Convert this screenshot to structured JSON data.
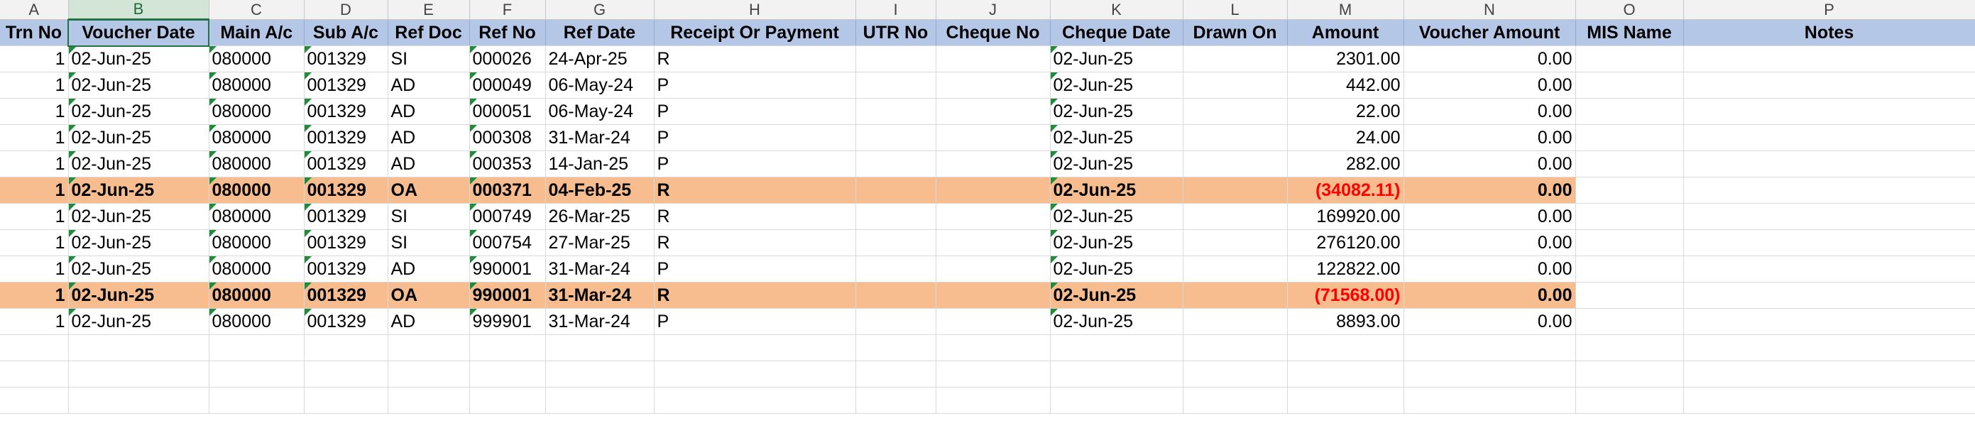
{
  "column_letters": [
    "A",
    "B",
    "C",
    "D",
    "E",
    "F",
    "G",
    "H",
    "I",
    "J",
    "K",
    "L",
    "M",
    "N",
    "O",
    "P"
  ],
  "selected_column": "B",
  "headers": [
    "Trn No",
    "Voucher Date",
    "Main A/c",
    "Sub A/c",
    "Ref Doc",
    "Ref No",
    "Ref Date",
    "Receipt Or Payment",
    "UTR No",
    "Cheque No",
    "Cheque Date",
    "Drawn On",
    "Amount",
    "Voucher Amount",
    "MIS Name",
    "Notes"
  ],
  "highlight_color": "#f8bd8e",
  "header_color": "#b4c7e7",
  "negative_color": "#ff0000",
  "rows": [
    {
      "trn": "1",
      "vdate": "02-Jun-25",
      "main": "080000",
      "sub": "001329",
      "refdoc": "SI",
      "refno": "000026",
      "refdate": "24-Apr-25",
      "rp": "R",
      "utr": "",
      "chq": "",
      "chqdate": "02-Jun-25",
      "drawn": "",
      "amount": "2301.00",
      "vamount": "0.00",
      "mis": "",
      "notes": "",
      "highlight": false,
      "negative": false
    },
    {
      "trn": "1",
      "vdate": "02-Jun-25",
      "main": "080000",
      "sub": "001329",
      "refdoc": "AD",
      "refno": "000049",
      "refdate": "06-May-24",
      "rp": "P",
      "utr": "",
      "chq": "",
      "chqdate": "02-Jun-25",
      "drawn": "",
      "amount": "442.00",
      "vamount": "0.00",
      "mis": "",
      "notes": "",
      "highlight": false,
      "negative": false
    },
    {
      "trn": "1",
      "vdate": "02-Jun-25",
      "main": "080000",
      "sub": "001329",
      "refdoc": "AD",
      "refno": "000051",
      "refdate": "06-May-24",
      "rp": "P",
      "utr": "",
      "chq": "",
      "chqdate": "02-Jun-25",
      "drawn": "",
      "amount": "22.00",
      "vamount": "0.00",
      "mis": "",
      "notes": "",
      "highlight": false,
      "negative": false
    },
    {
      "trn": "1",
      "vdate": "02-Jun-25",
      "main": "080000",
      "sub": "001329",
      "refdoc": "AD",
      "refno": "000308",
      "refdate": "31-Mar-24",
      "rp": "P",
      "utr": "",
      "chq": "",
      "chqdate": "02-Jun-25",
      "drawn": "",
      "amount": "24.00",
      "vamount": "0.00",
      "mis": "",
      "notes": "",
      "highlight": false,
      "negative": false
    },
    {
      "trn": "1",
      "vdate": "02-Jun-25",
      "main": "080000",
      "sub": "001329",
      "refdoc": "AD",
      "refno": "000353",
      "refdate": "14-Jan-25",
      "rp": "P",
      "utr": "",
      "chq": "",
      "chqdate": "02-Jun-25",
      "drawn": "",
      "amount": "282.00",
      "vamount": "0.00",
      "mis": "",
      "notes": "",
      "highlight": false,
      "negative": false
    },
    {
      "trn": "1",
      "vdate": "02-Jun-25",
      "main": "080000",
      "sub": "001329",
      "refdoc": "OA",
      "refno": "000371",
      "refdate": "04-Feb-25",
      "rp": "R",
      "utr": "",
      "chq": "",
      "chqdate": "02-Jun-25",
      "drawn": "",
      "amount": "(34082.11)",
      "vamount": "0.00",
      "mis": "",
      "notes": "",
      "highlight": true,
      "negative": true
    },
    {
      "trn": "1",
      "vdate": "02-Jun-25",
      "main": "080000",
      "sub": "001329",
      "refdoc": "SI",
      "refno": "000749",
      "refdate": "26-Mar-25",
      "rp": "R",
      "utr": "",
      "chq": "",
      "chqdate": "02-Jun-25",
      "drawn": "",
      "amount": "169920.00",
      "vamount": "0.00",
      "mis": "",
      "notes": "",
      "highlight": false,
      "negative": false
    },
    {
      "trn": "1",
      "vdate": "02-Jun-25",
      "main": "080000",
      "sub": "001329",
      "refdoc": "SI",
      "refno": "000754",
      "refdate": "27-Mar-25",
      "rp": "R",
      "utr": "",
      "chq": "",
      "chqdate": "02-Jun-25",
      "drawn": "",
      "amount": "276120.00",
      "vamount": "0.00",
      "mis": "",
      "notes": "",
      "highlight": false,
      "negative": false
    },
    {
      "trn": "1",
      "vdate": "02-Jun-25",
      "main": "080000",
      "sub": "001329",
      "refdoc": "AD",
      "refno": "990001",
      "refdate": "31-Mar-24",
      "rp": "P",
      "utr": "",
      "chq": "",
      "chqdate": "02-Jun-25",
      "drawn": "",
      "amount": "122822.00",
      "vamount": "0.00",
      "mis": "",
      "notes": "",
      "highlight": false,
      "negative": false
    },
    {
      "trn": "1",
      "vdate": "02-Jun-25",
      "main": "080000",
      "sub": "001329",
      "refdoc": "OA",
      "refno": "990001",
      "refdate": "31-Mar-24",
      "rp": "R",
      "utr": "",
      "chq": "",
      "chqdate": "02-Jun-25",
      "drawn": "",
      "amount": "(71568.00)",
      "vamount": "0.00",
      "mis": "",
      "notes": "",
      "highlight": true,
      "negative": true
    },
    {
      "trn": "1",
      "vdate": "02-Jun-25",
      "main": "080000",
      "sub": "001329",
      "refdoc": "AD",
      "refno": "999901",
      "refdate": "31-Mar-24",
      "rp": "P",
      "utr": "",
      "chq": "",
      "chqdate": "02-Jun-25",
      "drawn": "",
      "amount": "8893.00",
      "vamount": "0.00",
      "mis": "",
      "notes": "",
      "highlight": false,
      "negative": false
    }
  ]
}
